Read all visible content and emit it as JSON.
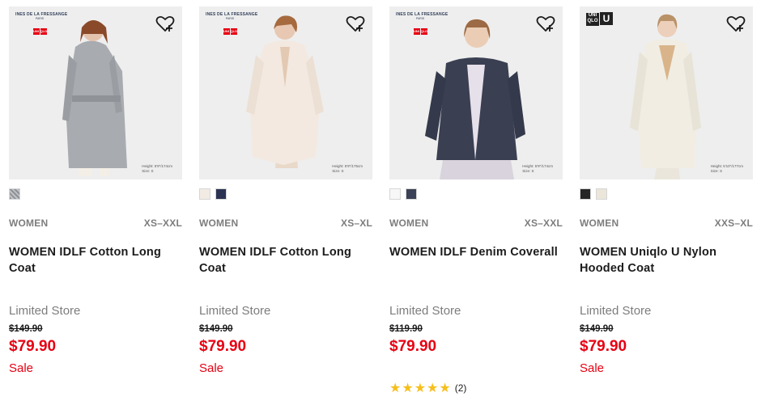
{
  "colors": {
    "sale_red": "#e60012",
    "meta_gray": "#7d7d7d",
    "star_yellow": "#f6bf1c"
  },
  "products": [
    {
      "brand_badge": {
        "type": "idlf",
        "line1": "INES DE LA FRESSANGE",
        "line2": "PARIS",
        "logo": [
          "UNI",
          "QLO"
        ]
      },
      "model_note": [
        "Height: 5'9\"/174cm",
        "Size: S"
      ],
      "swatches": [
        {
          "name": "gray-check",
          "color": "#a7a9ad"
        }
      ],
      "gender": "WOMEN",
      "sizes": "XS–XXL",
      "name": "WOMEN IDLF Cotton Long Coat",
      "store": "Limited Store",
      "original_price": "$149.90",
      "price": "$79.90",
      "sale_label": "Sale"
    },
    {
      "brand_badge": {
        "type": "idlf",
        "line1": "INES DE LA FRESSANGE",
        "line2": "PARIS",
        "logo": [
          "UNI",
          "QLO"
        ]
      },
      "model_note": [
        "Height: 5'9\"/175cm",
        "Size: S"
      ],
      "swatches": [
        {
          "name": "off-white",
          "color": "#f2ebe4"
        },
        {
          "name": "navy",
          "color": "#2a3352"
        }
      ],
      "gender": "WOMEN",
      "sizes": "XS–XL",
      "name": "WOMEN IDLF Cotton Long Coat",
      "store": "Limited Store",
      "original_price": "$149.90",
      "price": "$79.90",
      "sale_label": "Sale"
    },
    {
      "brand_badge": {
        "type": "idlf",
        "line1": "INES DE LA FRESSANGE",
        "line2": "PARIS",
        "logo": [
          "UNI",
          "QLO"
        ]
      },
      "model_note": [
        "Height: 5'9\"/174cm",
        "Size: S"
      ],
      "swatches": [
        {
          "name": "white",
          "color": "#f4f4f4"
        },
        {
          "name": "denim-navy",
          "color": "#3b4156"
        }
      ],
      "gender": "WOMEN",
      "sizes": "XS–XXL",
      "name": "WOMEN IDLF Denim Coverall",
      "store": "Limited Store",
      "original_price": "$119.90",
      "price": "$79.90",
      "sale_label": "",
      "rating": {
        "stars": "★★★★★",
        "count": "(2)"
      }
    },
    {
      "brand_badge": {
        "type": "uniqlo-u",
        "logo": [
          "UNI QLO",
          "U"
        ]
      },
      "model_note": [
        "Height: 5'10\"/177cm",
        "Size: S"
      ],
      "swatches": [
        {
          "name": "black",
          "color": "#262626"
        },
        {
          "name": "natural",
          "color": "#ece6da"
        }
      ],
      "gender": "WOMEN",
      "sizes": "XXS–XL",
      "name": "WOMEN Uniqlo U Nylon Hooded Coat",
      "store": "Limited Store",
      "original_price": "$149.90",
      "price": "$79.90",
      "sale_label": "Sale"
    }
  ]
}
